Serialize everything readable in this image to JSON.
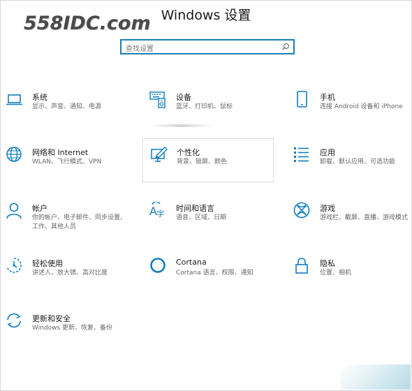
{
  "window": {
    "title": "Windows 设置"
  },
  "watermark": {
    "text": "558IDC.com"
  },
  "search": {
    "placeholder": "查找设置",
    "icon": "search-icon"
  },
  "accent_color": "#0f7cc1",
  "tiles": [
    {
      "name": "系统",
      "desc": "显示、声音、通知、电源",
      "icon": "laptop-icon"
    },
    {
      "name": "设备",
      "desc": "蓝牙、打印机、鼠标",
      "icon": "devices-icon"
    },
    {
      "name": "手机",
      "desc": "连接 Android 设备和 iPhone",
      "icon": "phone-icon"
    },
    {
      "name": "网络和 Internet",
      "desc": "WLAN、飞行模式、VPN",
      "icon": "globe-icon"
    },
    {
      "name": "个性化",
      "desc": "背景、锁屏、颜色",
      "icon": "brush-icon"
    },
    {
      "name": "应用",
      "desc": "卸载、默认应用、可选功能",
      "icon": "apps-list-icon"
    },
    {
      "name": "帐户",
      "desc": "你的帐户、电子邮件、同步设置、工作、其他人员",
      "icon": "person-icon"
    },
    {
      "name": "时间和语言",
      "desc": "语音、区域、日期",
      "icon": "time-language-icon"
    },
    {
      "name": "游戏",
      "desc": "游戏栏、截屏、直播、游戏模式",
      "icon": "xbox-icon"
    },
    {
      "name": "轻松使用",
      "desc": "讲述人、放大镜、高对比度",
      "icon": "ease-of-access-icon"
    },
    {
      "name": "Cortana",
      "desc": "Cortana 语言、权限、通知",
      "icon": "cortana-icon"
    },
    {
      "name": "隐私",
      "desc": "位置、相机",
      "icon": "lock-icon"
    },
    {
      "name": "更新和安全",
      "desc": "Windows 更新、恢复、备份",
      "icon": "sync-icon"
    }
  ]
}
